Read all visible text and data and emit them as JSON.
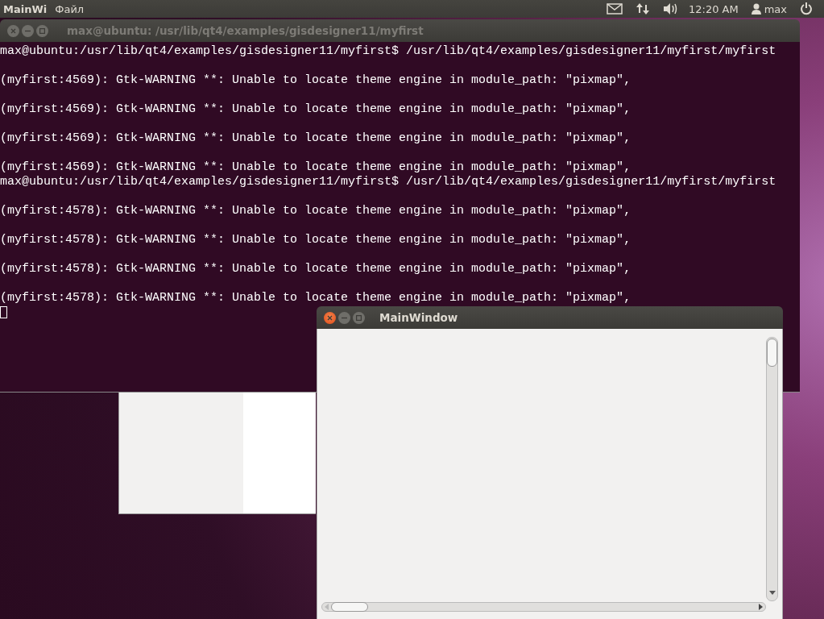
{
  "top_panel": {
    "app_name": "MainWi",
    "menu": [
      "Файл"
    ],
    "clock": "12:20 AM",
    "user": "max"
  },
  "terminal": {
    "title": "max@ubuntu: /usr/lib/qt4/examples/gisdesigner11/myfirst",
    "focused": false,
    "lines": [
      {
        "kind": "prompt",
        "text": "max@ubuntu:/usr/lib/qt4/examples/gisdesigner11/myfirst$ /usr/lib/qt4/examples/gisdesigner11/myfirst/myfirst"
      },
      {
        "kind": "output",
        "text": "(myfirst:4569): Gtk-WARNING **: Unable to locate theme engine in module_path: \"pixmap\","
      },
      {
        "kind": "output",
        "text": "(myfirst:4569): Gtk-WARNING **: Unable to locate theme engine in module_path: \"pixmap\","
      },
      {
        "kind": "output",
        "text": "(myfirst:4569): Gtk-WARNING **: Unable to locate theme engine in module_path: \"pixmap\","
      },
      {
        "kind": "output",
        "text": "(myfirst:4569): Gtk-WARNING **: Unable to locate theme engine in module_path: \"pixmap\","
      },
      {
        "kind": "prompt",
        "text": "max@ubuntu:/usr/lib/qt4/examples/gisdesigner11/myfirst$ /usr/lib/qt4/examples/gisdesigner11/myfirst/myfirst"
      },
      {
        "kind": "output",
        "text": "(myfirst:4578): Gtk-WARNING **: Unable to locate theme engine in module_path: \"pixmap\","
      },
      {
        "kind": "output",
        "text": "(myfirst:4578): Gtk-WARNING **: Unable to locate theme engine in module_path: \"pixmap\","
      },
      {
        "kind": "output",
        "text": "(myfirst:4578): Gtk-WARNING **: Unable to locate theme engine in module_path: \"pixmap\","
      },
      {
        "kind": "output",
        "text": "(myfirst:4578): Gtk-WARNING **: Unable to locate theme engine in module_path: \"pixmap\","
      }
    ]
  },
  "main_window": {
    "title": "MainWindow",
    "focused": true
  }
}
